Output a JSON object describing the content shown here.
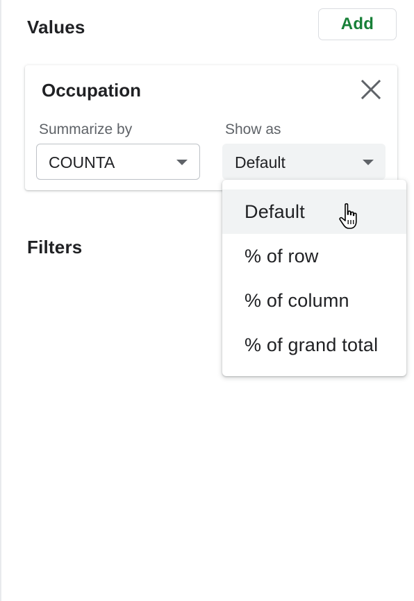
{
  "values_section": {
    "title": "Values",
    "add_label": "Add"
  },
  "value_card": {
    "title": "Occupation",
    "summarize_label": "Summarize by",
    "summarize_value": "COUNTA",
    "show_as_label": "Show as",
    "show_as_value": "Default"
  },
  "show_as_menu": {
    "items": [
      {
        "label": "Default"
      },
      {
        "label": "% of row"
      },
      {
        "label": "% of column"
      },
      {
        "label": "% of grand total"
      }
    ],
    "hovered_index": 0
  },
  "filters_section": {
    "title": "Filters"
  },
  "colors": {
    "accent_green": "#188038",
    "text_primary": "#202124",
    "text_secondary": "#5f6368",
    "hover_bg": "#f1f3f4"
  },
  "icons": [
    "close-icon",
    "dropdown-arrow-icon",
    "hand-pointer-cursor"
  ]
}
